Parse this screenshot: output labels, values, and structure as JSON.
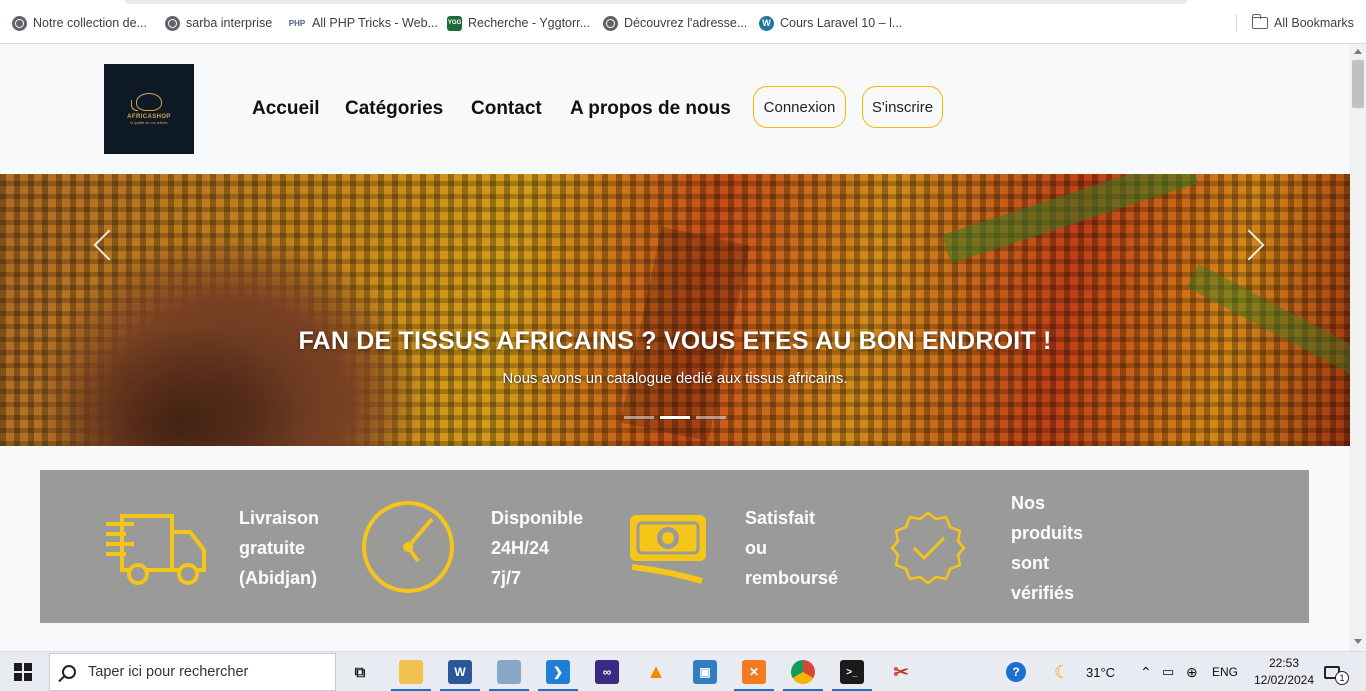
{
  "bookmarks": {
    "items": [
      {
        "label": "Notre collection de...",
        "icon": "globe-icon"
      },
      {
        "label": "sarba interprise",
        "icon": "globe-icon"
      },
      {
        "label": "All PHP Tricks - Web...",
        "icon": "php-icon"
      },
      {
        "label": "Recherche - Yggtorr...",
        "icon": "ygg-icon"
      },
      {
        "label": "Découvrez l'adresse...",
        "icon": "globe-icon"
      },
      {
        "label": "Cours Laravel 10 – l...",
        "icon": "wordpress-icon"
      }
    ],
    "all_bookmarks": "All Bookmarks",
    "php_badge": "PHP",
    "ygg_badge": "YGG"
  },
  "logo": {
    "name": "AFRICASHOP",
    "tagline": "la qualité de vos articles"
  },
  "nav": {
    "links": [
      "Accueil",
      "Catégories",
      "Contact",
      "A propos de nous"
    ],
    "login": "Connexion",
    "signup": "S'inscrire"
  },
  "carousel": {
    "title": "FAN DE TISSUS AFRICAINS ? VOUS ETES AU BON ENDROIT !",
    "subtitle": "Nous avons un catalogue dedié aux tissus africains.",
    "slide_count": 3,
    "active_slide": 2
  },
  "features": [
    {
      "icon": "truck-icon",
      "lines": [
        "Livraison",
        "gratuite",
        "(Abidjan)"
      ]
    },
    {
      "icon": "clock-icon",
      "lines": [
        "Disponible",
        "24H/24",
        "7j/7"
      ]
    },
    {
      "icon": "money-icon",
      "lines": [
        "Satisfait",
        "ou",
        "remboursé"
      ]
    },
    {
      "icon": "verified-badge-icon",
      "lines": [
        "Nos",
        "produits",
        "sont",
        "vérifiés"
      ]
    }
  ],
  "colors": {
    "accent": "#f5c518",
    "features_bg": "#9a9a99",
    "logo_bg": "#0d1a26"
  },
  "taskbar": {
    "search_placeholder": "Taper ici pour rechercher",
    "temperature": "31°C",
    "language": "ENG",
    "time": "22:53",
    "date": "12/02/2024",
    "notification_count": "1",
    "apps": [
      "task-view-icon",
      "file-explorer-icon",
      "word-icon",
      "photos-icon",
      "vscode-icon",
      "visual-studio-icon",
      "vlc-icon",
      "virtualbox-icon",
      "xampp-icon",
      "chrome-icon",
      "terminal-icon",
      "snipping-tool-icon"
    ]
  }
}
